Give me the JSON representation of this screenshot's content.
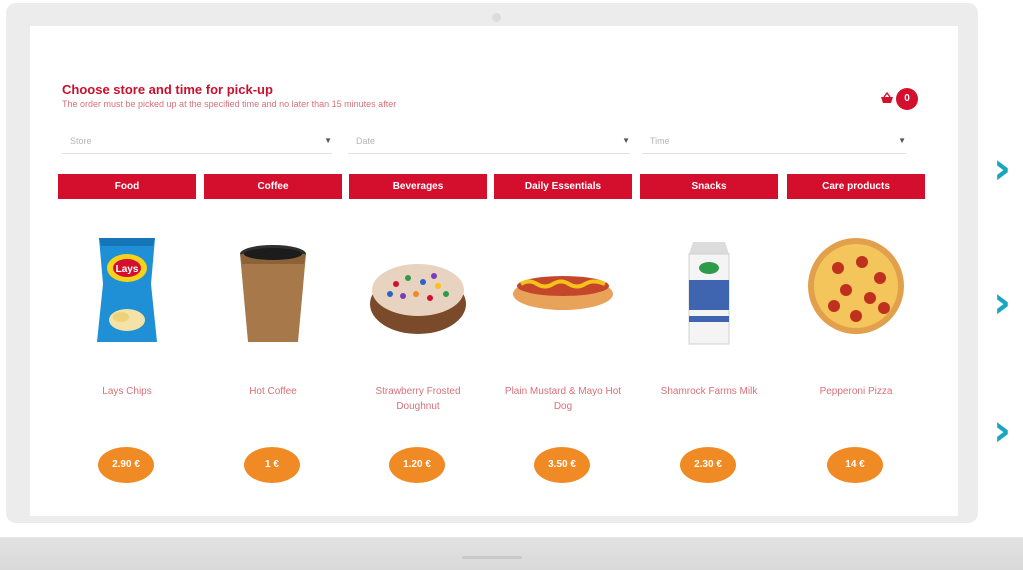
{
  "header": {
    "title": "Choose store and time for pick-up",
    "subtitle": "The order must be picked up at the specified time and no later than 15 minutes after"
  },
  "cart": {
    "icon": "basket-icon",
    "count": "0",
    "badge_color": "#d40f2e"
  },
  "filters": {
    "store_placeholder": "Store",
    "date_placeholder": "Date",
    "time_placeholder": "Time"
  },
  "tabs": [
    "Food",
    "Coffee",
    "Beverages",
    "Daily Essentials",
    "Snacks",
    "Care products"
  ],
  "products": [
    {
      "name": "Lays Chips",
      "price": "2.90 €",
      "icon": "chips-bag-image"
    },
    {
      "name": "Hot Coffee",
      "price": "1 €",
      "icon": "coffee-cup-image"
    },
    {
      "name": "Strawberry Frosted Doughnut",
      "price": "1.20 €",
      "icon": "doughnut-image"
    },
    {
      "name": "Plain Mustard & Mayo Hot Dog",
      "price": "3.50 €",
      "icon": "hot-dog-image"
    },
    {
      "name": "Shamrock Farms Milk",
      "price": "2.30 €",
      "icon": "milk-carton-image"
    },
    {
      "name": "Pepperoni Pizza",
      "price": "14 €",
      "icon": "pizza-image"
    }
  ],
  "colors": {
    "accent": "#d40f2e",
    "price_badge": "#f08a24",
    "decor": "#1aa6bd"
  }
}
